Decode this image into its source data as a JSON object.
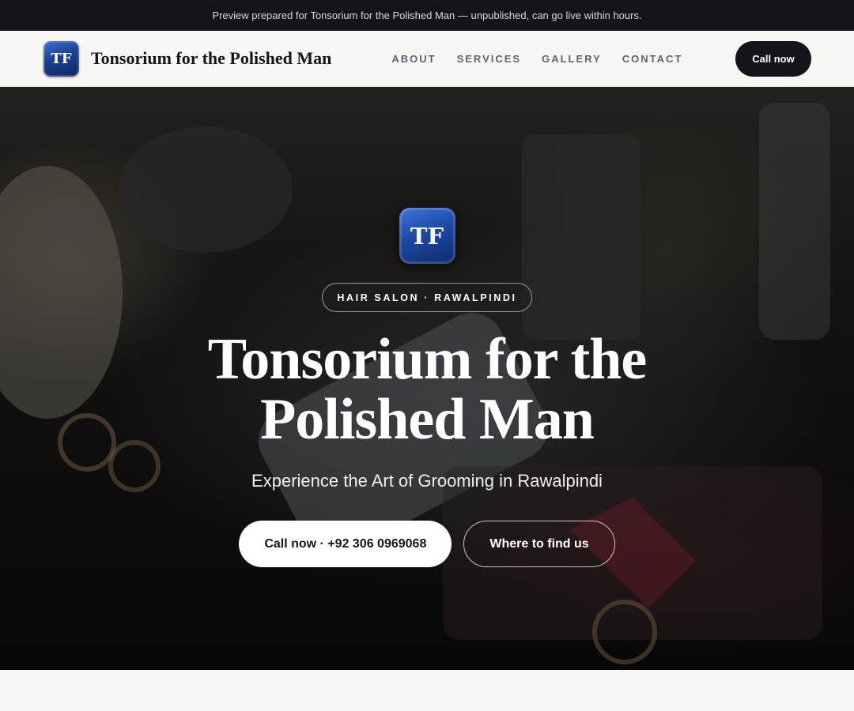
{
  "preview_banner": "Preview prepared for Tonsorium for the Polished Man — unpublished, can go live within hours.",
  "header": {
    "logo_text": "TF",
    "brand_name": "Tonsorium for the Polished Man",
    "nav": [
      "ABOUT",
      "SERVICES",
      "GALLERY",
      "CONTACT"
    ],
    "cta_label": "Call now"
  },
  "hero": {
    "logo_text": "TF",
    "badge": "HAIR SALON · RAWALPINDI",
    "title": "Tonsorium for the Polished Man",
    "subtitle": "Experience the Art of Grooming in Rawalpindi",
    "primary_button": "Call now · +92 306 0969068",
    "secondary_button": "Where to find us"
  },
  "colors": {
    "logo_blue": "#1d4aa5",
    "dark": "#121419",
    "page_bg": "#f8f7f4"
  },
  "icons": {
    "logo": "tf-monogram-icon"
  }
}
